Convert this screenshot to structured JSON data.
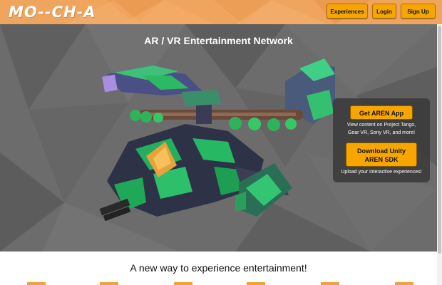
{
  "header": {
    "logo_text": "MO--CH-A",
    "background_color": "#f0a55e",
    "nav": [
      {
        "label": "Experiences"
      },
      {
        "label": "Login"
      },
      {
        "label": "Sign Up"
      }
    ],
    "button_color": "#f7a600"
  },
  "hero": {
    "title": "AR / VR Entertainment Network",
    "image": "helicopter-model",
    "panel": {
      "app_button": "Get AREN App",
      "app_caption_line1": "View content on Project Tango,",
      "app_caption_line2": "Gear VR, Sony VR, and more!",
      "sdk_button_line1": "Download Unity",
      "sdk_button_line2": "AREN SDK",
      "sdk_caption": "Upload your interactive experiences!"
    }
  },
  "tagline": "A new way to experience entertainment!"
}
